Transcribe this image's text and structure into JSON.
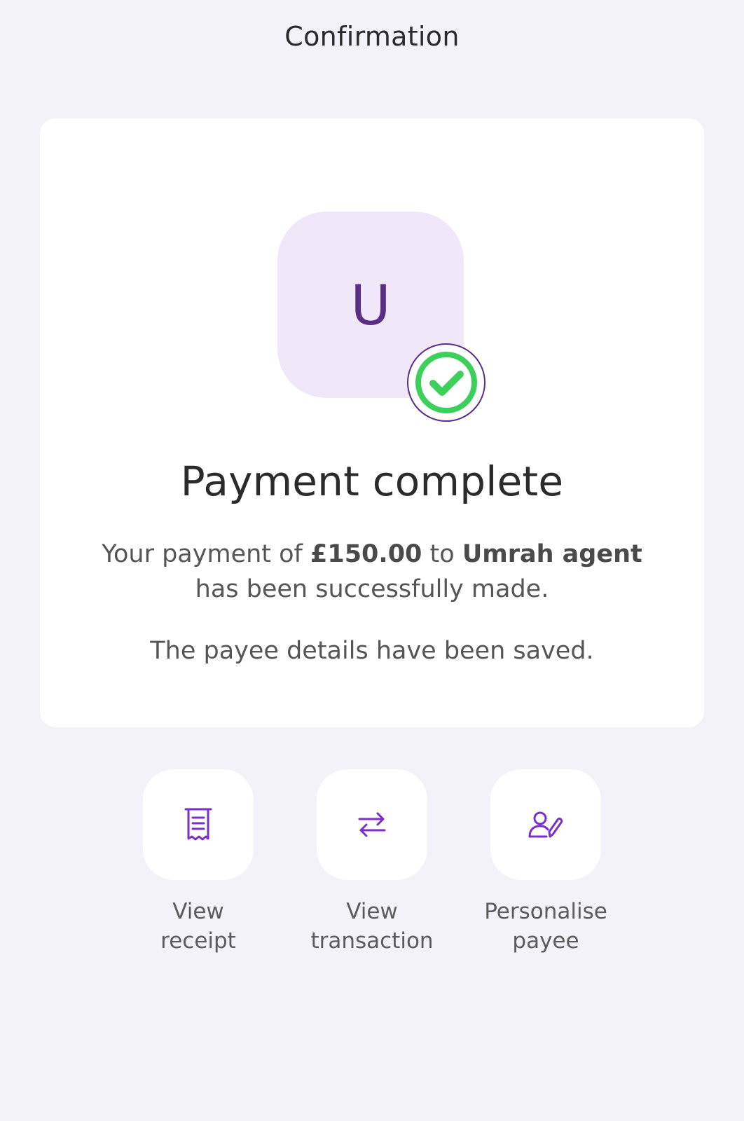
{
  "header": {
    "title": "Confirmation"
  },
  "payee": {
    "initial": "U"
  },
  "result": {
    "title": "Payment complete",
    "message_prefix": "Your payment of ",
    "amount": "£150.00",
    "message_mid": " to ",
    "payee_name": "Umrah agent",
    "message_suffix": "has been successfully made.",
    "saved_note": "The payee details have been saved."
  },
  "actions": [
    {
      "label_line1": "View",
      "label_line2": "receipt",
      "icon": "receipt-icon"
    },
    {
      "label_line1": "View",
      "label_line2": "transaction",
      "icon": "transfer-arrows-icon"
    },
    {
      "label_line1": "Personalise",
      "label_line2": "payee",
      "icon": "person-edit-icon"
    }
  ],
  "colors": {
    "background": "#f3f2f8",
    "accent": "#5a2d86",
    "icon": "#7a2fc8",
    "success": "#3ccf5a",
    "avatar_bg": "#f0e8f9"
  }
}
